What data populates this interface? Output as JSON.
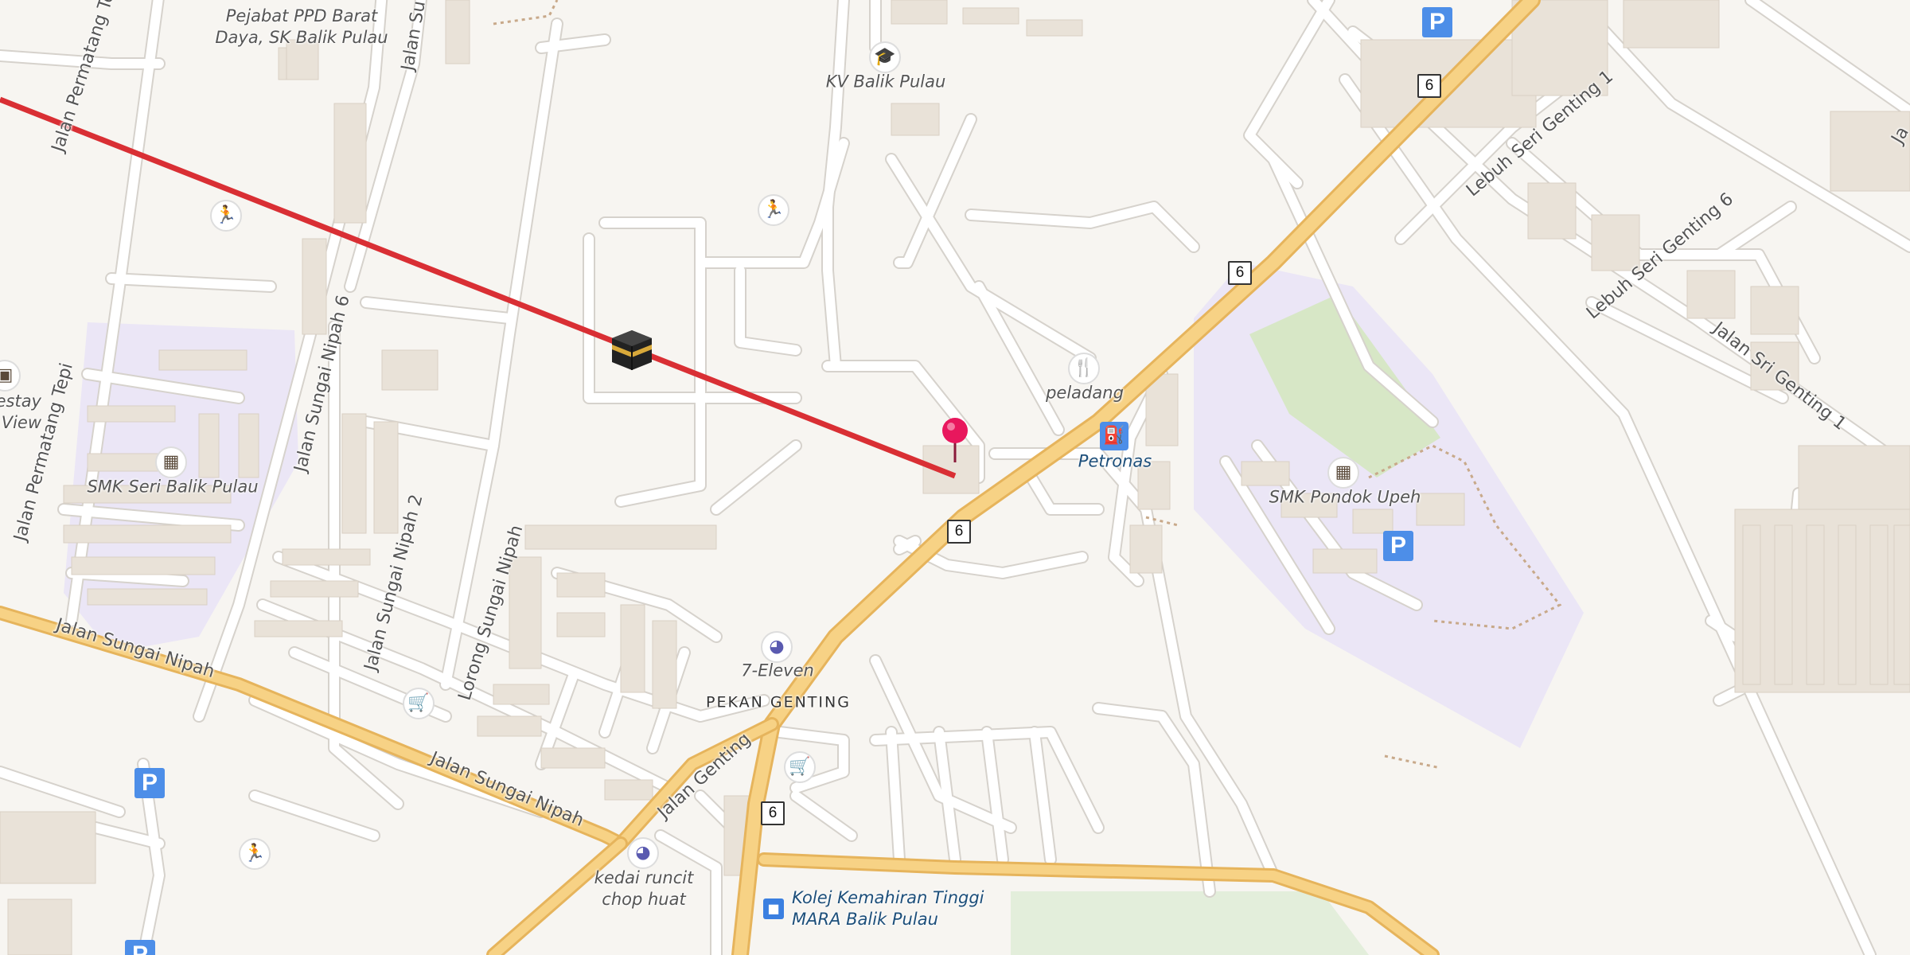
{
  "map": {
    "colors": {
      "background": "#f7f5f1",
      "road": "#ffffff",
      "road_casing": "#d6d2cc",
      "highway": "#f7d285",
      "highway_casing": "#e6b45c",
      "building": "#e9e2d8",
      "school_area": "#ebe6f6",
      "field": "#d7e7c6",
      "qibla_line": "#d92f34",
      "pin": "#e8175d"
    },
    "qibla_line": "qibla-direction-line",
    "route_shields": [
      "6",
      "6",
      "6",
      "6"
    ],
    "places": {
      "pejabat": "Pejabat PPD Barat\nDaya, SK Balik Pulau",
      "kv": "KV Balik Pulau",
      "homestay": "estay\ny View",
      "smk_seri": "SMK Seri Balik Pulau",
      "peladang": "peladang",
      "petronas": "Petronas",
      "smk_pondok": "SMK Pondok Upeh",
      "seven_eleven": "7-Eleven",
      "pekan_genting": "PEKAN GENTING",
      "kedai": "kedai runcit\nchop huat",
      "kolej": "Kolej Kemahiran Tinggi\nMARA Balik Pulau"
    },
    "roads": {
      "permatang_te": "Jalan Permatang Te",
      "permatang_tepi": "Jalan Permatang Tepi",
      "sungai_nipah_6": "Jalan Sungai Nipah 6",
      "sungai_nipah_2": "Jalan Sungai Nipah 2",
      "lorong_sungai_nipah": "Lorong Sungai Nipah",
      "jalan_su": "Jalan Su",
      "sungai_nipah_a": "Jalan Sungai Nipah",
      "sungai_nipah_b": "Jalan Sungai Nipah",
      "genting": "Jalan Genting",
      "lebuh_seri_genting_1": "Lebuh Seri Genting 1",
      "lebuh_seri_genting_6": "Lebuh Seri Genting 6",
      "sri_genting_1": "Jalan Sri Genting 1",
      "ja": "Ja"
    },
    "icons": {
      "parking": "P",
      "fuel": "fuel-icon",
      "restaurant": "restaurant-icon",
      "school": "school-icon",
      "college": "college-icon",
      "sport": "sport-icon",
      "shop": "shop-icon",
      "supermarket": "supermarket-icon",
      "bus": "bus-stop-icon",
      "homestay": "bed-icon"
    }
  }
}
